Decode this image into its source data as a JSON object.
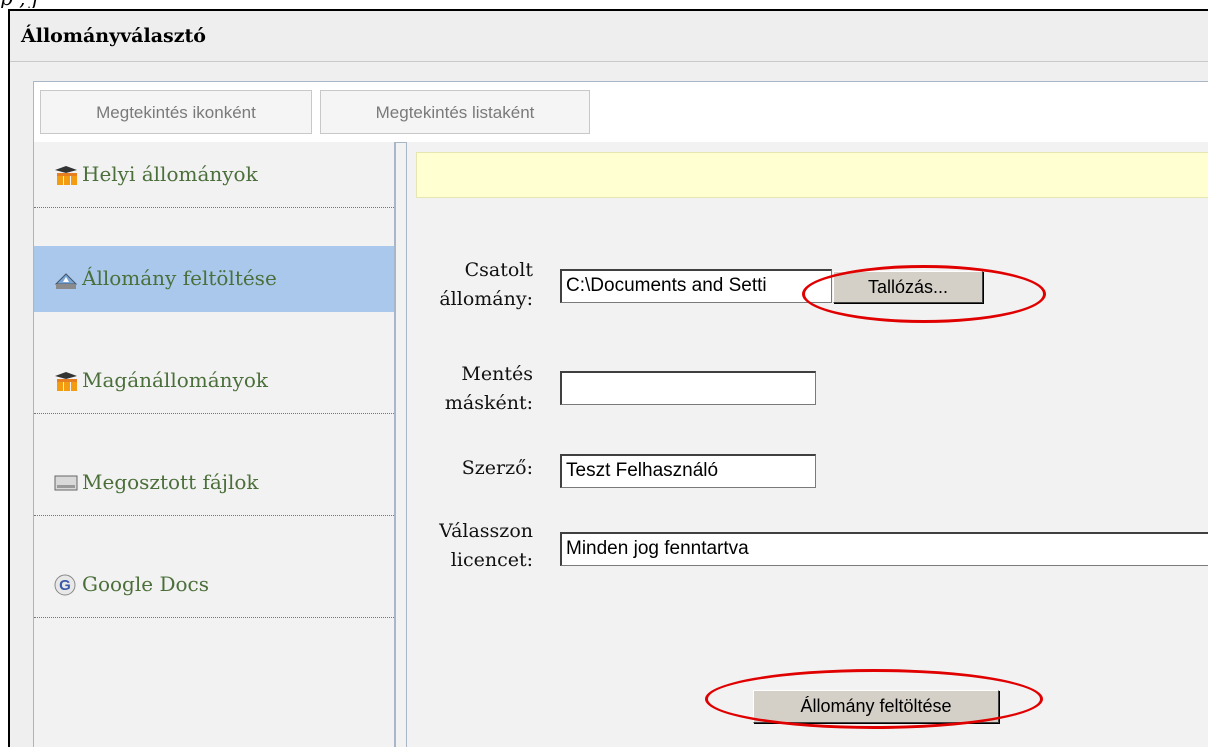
{
  "top_cut_text": "p                    ,         j",
  "dialog": {
    "title": "Állományválasztó"
  },
  "tabs": [
    {
      "label": "Megtekintés ikonként"
    },
    {
      "label": "Megtekintés listaként"
    }
  ],
  "sidebar": {
    "items": [
      {
        "label": "Helyi állományok",
        "icon": "moodle-icon"
      },
      {
        "label": "Állomány feltöltése",
        "icon": "upload-icon",
        "selected": true
      },
      {
        "label": "Magánállományok",
        "icon": "moodle-icon"
      },
      {
        "label": "Megosztott fájlok",
        "icon": "drive-icon"
      },
      {
        "label": "Google Docs",
        "icon": "google-icon"
      }
    ]
  },
  "form": {
    "attachment": {
      "label_line1": "Csatolt",
      "label_line2": "állomány:",
      "value": "C:\\Documents and Setti",
      "browse_label": "Tallózás..."
    },
    "save_as": {
      "label_line1": "Mentés",
      "label_line2": "másként:",
      "value": ""
    },
    "author": {
      "label": "Szerző:",
      "value": "Teszt Felhasználó"
    },
    "license": {
      "label_line1": "Válasszon",
      "label_line2": "licencet:",
      "value": "Minden jog fenntartva"
    },
    "upload_button": "Állomány feltöltése"
  },
  "colors": {
    "highlight": "#e00000",
    "selected_bg": "#a9c8ec",
    "notice_bg": "#ffffd2",
    "link_green": "#4b6f3a"
  }
}
